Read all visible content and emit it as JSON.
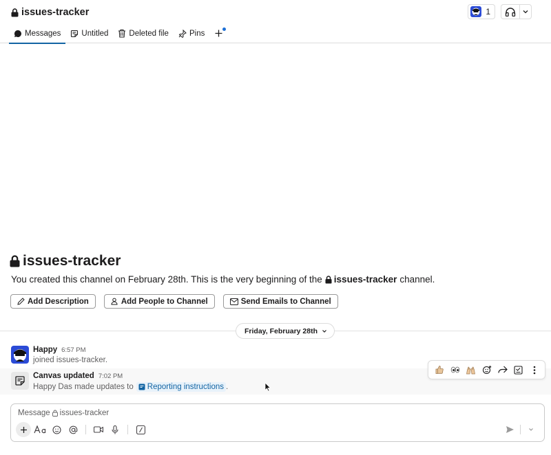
{
  "channel": {
    "name": "issues-tracker",
    "member_count": "1"
  },
  "tabs": [
    {
      "label": "Messages"
    },
    {
      "label": "Untitled"
    },
    {
      "label": "Deleted file"
    },
    {
      "label": "Pins"
    }
  ],
  "intro": {
    "title": "issues-tracker",
    "text_before": "You created this channel on February 28th. This is the very beginning of the",
    "channel_name": "issues-tracker",
    "text_after": "channel.",
    "buttons": [
      "Add Description",
      "Add People to Channel",
      "Send Emails to Channel"
    ]
  },
  "date_divider": "Friday, February 28th",
  "messages": [
    {
      "sender": "Happy",
      "time": "6:57 PM",
      "text": "joined issues-tracker."
    },
    {
      "sender": "Canvas updated",
      "time": "7:02 PM",
      "text": "Happy Das made updates to",
      "link": "Reporting instructions",
      "suffix": "."
    }
  ],
  "message_actions": [
    "thumbs-up-icon",
    "eyes-icon",
    "raised-hands-icon",
    "add-reaction-icon",
    "forward-icon",
    "save-icon",
    "more-icon"
  ],
  "composer": {
    "placeholder_prefix": "Message",
    "placeholder_channel": "issues-tracker"
  },
  "colors": {
    "accent": "#1264a3",
    "notification_dot": "#1d6fd6"
  }
}
